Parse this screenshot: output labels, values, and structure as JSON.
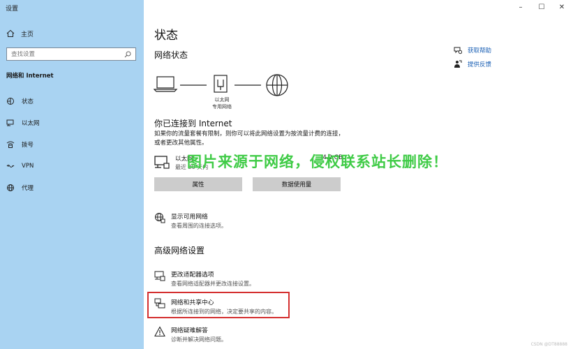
{
  "window": {
    "title": "设置",
    "controls": {
      "minimize": "–",
      "maximize": "☐",
      "close": "✕"
    }
  },
  "sidebar": {
    "home_label": "主页",
    "search_placeholder": "查找设置",
    "section": "网络和 Internet",
    "items": [
      {
        "label": "状态",
        "icon": "status-icon"
      },
      {
        "label": "以太网",
        "icon": "ethernet-icon"
      },
      {
        "label": "拨号",
        "icon": "dialup-icon"
      },
      {
        "label": "VPN",
        "icon": "vpn-icon"
      },
      {
        "label": "代理",
        "icon": "globe-icon"
      }
    ]
  },
  "main": {
    "title": "状态",
    "network_status_heading": "网络状态",
    "diagram_label_line1": "以太网",
    "diagram_label_line2": "专用网络",
    "connected_heading": "你已连接到 Internet",
    "connected_desc": "如果你的流量套餐有限制，则你可以将此网络设置为按流量计费的连接，或者更改其他属性。",
    "adapter": {
      "name": "以太网",
      "duration": "最近 30 天内",
      "usage": "4.2 GB"
    },
    "buttons": {
      "properties": "属性",
      "data_usage": "数据使用量"
    },
    "show_networks": {
      "title": "显示可用网络",
      "desc": "查看周围的连接选项。"
    },
    "advanced_heading": "高级网络设置",
    "advanced_items": [
      {
        "title": "更改适配器选项",
        "desc": "查看网络适配器并更改连接设置。"
      },
      {
        "title": "网络和共享中心",
        "desc": "根据所连接到的网络，决定要共享的内容。"
      },
      {
        "title": "网络疑难解答",
        "desc": "诊断并解决网络问题。"
      }
    ]
  },
  "help": {
    "get_help": "获取帮助",
    "feedback": "提供反馈"
  },
  "watermark": "图片来源于网络，侵权联系站长删除！",
  "credit": "CSDN @DT88888"
}
